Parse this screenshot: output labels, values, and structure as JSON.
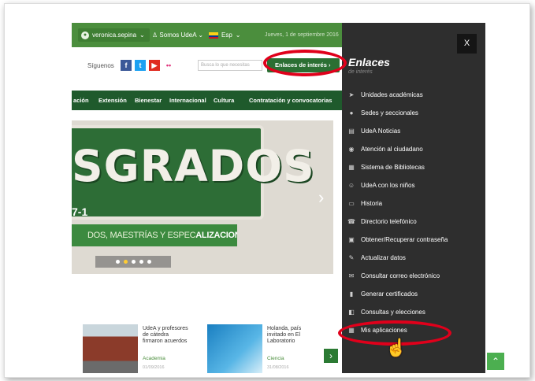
{
  "topbar": {
    "user": "veronica.sepina",
    "somos": "Somos UdeA",
    "lang": "Esp",
    "date": "Jueves, 1 de septiembre 2016"
  },
  "social": {
    "label": "Síguenos",
    "search_placeholder": "Busca lo que necesitas",
    "enlaces_button": "Enlaces de interés"
  },
  "nav": {
    "items": [
      "ación",
      "Extensión",
      "Bienestar",
      "Internacional",
      "Cultura",
      "Contratación y convocatorias"
    ]
  },
  "banner": {
    "headline": "SGRADOS",
    "tag": "7-1",
    "subline_a": "DOS, MAESTRÍAS Y ESPEC",
    "subline_b": "ALIZACIONES"
  },
  "news": [
    {
      "title": "UdeA y profesores de cátedra firmaron acuerdos",
      "category": "Academia",
      "date": "01/09/2016"
    },
    {
      "title": "Holanda, país invitado en El Laboratorio",
      "category": "Ciencia",
      "date": "31/08/2016"
    }
  ],
  "panel": {
    "close": "X",
    "title": "Enlaces",
    "subtitle": "de interés",
    "items": [
      {
        "label": "Unidades académicas",
        "icon": "tag-icon"
      },
      {
        "label": "Sedes y seccionales",
        "icon": "location-icon"
      },
      {
        "label": "UdeA Noticias",
        "icon": "news-icon"
      },
      {
        "label": "Atención al ciudadano",
        "icon": "info-icon"
      },
      {
        "label": "Sistema de Bibliotecas",
        "icon": "library-icon"
      },
      {
        "label": "UdeA con los niños",
        "icon": "child-icon"
      },
      {
        "label": "Historia",
        "icon": "book-icon"
      },
      {
        "label": "Directorio telefónico",
        "icon": "phone-icon"
      },
      {
        "label": "Obtener/Recuperar contraseña",
        "icon": "lock-icon"
      },
      {
        "label": "Actualizar datos",
        "icon": "pencil-icon"
      },
      {
        "label": "Consultar correo electrónico",
        "icon": "mail-icon"
      },
      {
        "label": "Generar certificados",
        "icon": "document-icon"
      },
      {
        "label": "Consultas y elecciones",
        "icon": "vote-icon"
      },
      {
        "label": "Mis aplicaciones",
        "icon": "grid-icon"
      }
    ]
  },
  "colors": {
    "brand_green": "#4b8e3d",
    "nav_green": "#1f5a2c",
    "panel_bg": "#2e2e2e",
    "annotation_red": "#e0001b"
  }
}
